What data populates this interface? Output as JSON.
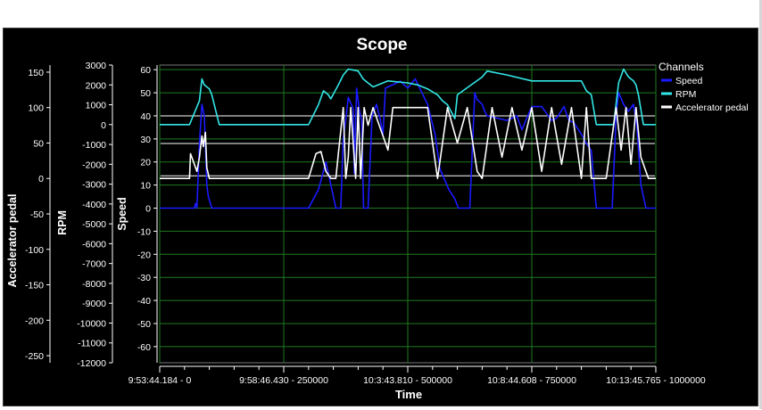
{
  "chart_data": {
    "type": "line",
    "title": "Scope",
    "xlabel": "Time",
    "x_ticks": [
      {
        "value": 0,
        "label": "9:53:44.184 - 0"
      },
      {
        "value": 250000,
        "label": "9:58:46.430 - 250000"
      },
      {
        "value": 500000,
        "label": "10:3:43.810 - 500000"
      },
      {
        "value": 750000,
        "label": "10:8:44.608 - 750000"
      },
      {
        "value": 1000000,
        "label": "10:13:45.765 - 1000000"
      }
    ],
    "xlim": [
      0,
      1000000
    ],
    "grid": true,
    "legend": {
      "title": "Channels",
      "placement": "right",
      "items": [
        {
          "name": "Speed",
          "color": "#1a1aff"
        },
        {
          "name": "RPM",
          "color": "#33e6e6"
        },
        {
          "name": "Accelerator pedal",
          "color": "#ffffff"
        }
      ]
    },
    "axes": [
      {
        "id": "accelerator",
        "label": "Accelerator pedal",
        "range": [
          -260,
          160
        ],
        "ticks": [
          150,
          100,
          50,
          0,
          -50,
          -100,
          -150,
          -200,
          -250
        ]
      },
      {
        "id": "rpm",
        "label": "RPM",
        "range": [
          -12000,
          3000
        ],
        "ticks": [
          3000,
          2000,
          1000,
          0,
          -1000,
          -2000,
          -3000,
          -4000,
          -5000,
          -6000,
          -7000,
          -8000,
          -9000,
          -10000,
          -11000,
          -12000
        ]
      },
      {
        "id": "speed",
        "label": "Speed",
        "range": [
          -67,
          62
        ],
        "ticks": [
          60,
          50,
          40,
          30,
          20,
          10,
          0,
          -10,
          -20,
          -30,
          -40,
          -50,
          -60
        ]
      }
    ],
    "series": [
      {
        "name": "Speed",
        "axis": "speed",
        "color": "#1a1aff",
        "x": [
          0,
          70000,
          72000,
          75000,
          80000,
          85000,
          90000,
          95000,
          98000,
          105000,
          115000,
          120000,
          300000,
          320000,
          335000,
          345000,
          355000,
          365000,
          370000,
          375000,
          380000,
          390000,
          392000,
          397000,
          402000,
          407000,
          411000,
          420000,
          428000,
          437000,
          445000,
          450000,
          455000,
          485000,
          500000,
          515000,
          540000,
          555000,
          565000,
          575000,
          583000,
          595000,
          602000,
          610000,
          625000,
          635000,
          640000,
          650000,
          655000,
          660000,
          700000,
          720000,
          730000,
          750000,
          770000,
          790000,
          800000,
          815000,
          825000,
          835000,
          850000,
          860000,
          870000,
          880000,
          898000,
          912000,
          920000,
          925000,
          935000,
          945000,
          955000,
          962000,
          970000,
          980000,
          990000,
          1000000
        ],
        "y": [
          0,
          0,
          2,
          0,
          28,
          45,
          40,
          10,
          5,
          0,
          0,
          0,
          0,
          8,
          20,
          10,
          0,
          0,
          30,
          38,
          48,
          43,
          15,
          52,
          43,
          38,
          0,
          0,
          40,
          45,
          38,
          32,
          52,
          55,
          52,
          56,
          45,
          32,
          17,
          12,
          8,
          4,
          0,
          0,
          0,
          50,
          47,
          45,
          42,
          40,
          38,
          40,
          34,
          44,
          44,
          38,
          39,
          44,
          38,
          37,
          32,
          28,
          25,
          0,
          0,
          0,
          40,
          50,
          45,
          42,
          45,
          35,
          10,
          0,
          0,
          0
        ]
      },
      {
        "name": "RPM",
        "axis": "rpm",
        "color": "#33e6e6",
        "x": [
          0,
          60000,
          80000,
          85000,
          90000,
          100000,
          105000,
          120000,
          300000,
          320000,
          330000,
          340000,
          345000,
          360000,
          370000,
          380000,
          400000,
          410000,
          430000,
          460000,
          500000,
          520000,
          540000,
          560000,
          570000,
          580000,
          595000,
          600000,
          650000,
          660000,
          700000,
          750000,
          800000,
          850000,
          860000,
          870000,
          880000,
          900000,
          915000,
          925000,
          935000,
          945000,
          955000,
          960000,
          965000,
          975000,
          1000000
        ],
        "y": [
          0,
          0,
          1200,
          2300,
          2000,
          1800,
          1500,
          0,
          0,
          1000,
          1700,
          1500,
          1300,
          2000,
          2500,
          2800,
          2700,
          2300,
          1900,
          2200,
          2100,
          2000,
          1800,
          1500,
          1200,
          1000,
          300,
          1500,
          2400,
          2700,
          2500,
          2200,
          2200,
          2200,
          1700,
          1500,
          0,
          0,
          0,
          2100,
          2800,
          2400,
          2200,
          2000,
          1500,
          0,
          0
        ]
      },
      {
        "name": "Accelerator pedal",
        "axis": "accelerator",
        "color": "#ffffff",
        "x": [
          0,
          60000,
          62000,
          75000,
          80000,
          85000,
          88000,
          92000,
          95000,
          100000,
          115000,
          300000,
          315000,
          325000,
          335000,
          345000,
          355000,
          360000,
          370000,
          375000,
          380000,
          385000,
          395000,
          400000,
          405000,
          412000,
          420000,
          430000,
          440000,
          460000,
          470000,
          480000,
          500000,
          520000,
          540000,
          560000,
          580000,
          600000,
          620000,
          640000,
          650000,
          670000,
          690000,
          710000,
          730000,
          750000,
          770000,
          790000,
          810000,
          830000,
          850000,
          860000,
          870000,
          880000,
          900000,
          920000,
          930000,
          940000,
          950000,
          960000,
          970000,
          985000,
          1000000
        ],
        "y": [
          0,
          0,
          35,
          10,
          30,
          60,
          45,
          65,
          15,
          0,
          0,
          0,
          35,
          38,
          10,
          0,
          0,
          35,
          100,
          0,
          30,
          100,
          0,
          100,
          0,
          100,
          75,
          100,
          80,
          40,
          100,
          100,
          100,
          100,
          100,
          0,
          100,
          50,
          100,
          10,
          0,
          100,
          30,
          100,
          40,
          100,
          10,
          100,
          20,
          100,
          0,
          100,
          0,
          0,
          0,
          100,
          40,
          100,
          20,
          100,
          30,
          0,
          0
        ]
      }
    ],
    "reference_lines": [
      {
        "axis": "speed",
        "value": 40,
        "color": "#ffffff"
      },
      {
        "axis": "speed",
        "value": 28,
        "color": "#ffffff"
      },
      {
        "axis": "speed",
        "value": 14,
        "color": "#ffffff"
      }
    ]
  }
}
